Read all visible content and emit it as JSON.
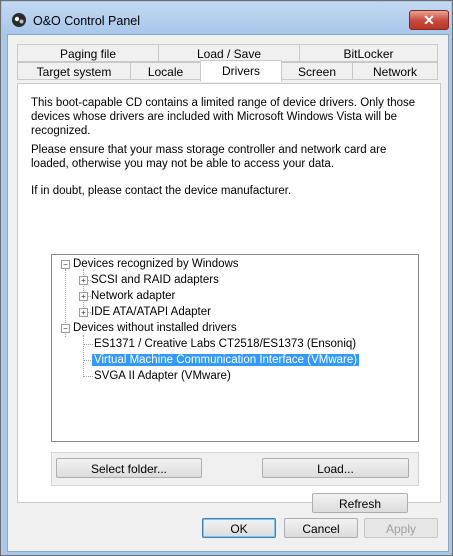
{
  "window": {
    "title": "O&O Control Panel",
    "close_symbol": "✕"
  },
  "tabs": {
    "row1": [
      {
        "label": "Paging file"
      },
      {
        "label": "Load / Save"
      },
      {
        "label": "BitLocker"
      }
    ],
    "row2": [
      {
        "label": "Target system"
      },
      {
        "label": "Locale"
      },
      {
        "label": "Drivers",
        "active": true
      },
      {
        "label": "Screen"
      },
      {
        "label": "Network"
      }
    ]
  },
  "drivers": {
    "paragraphs": [
      "This boot-capable CD contains a limited range of device drivers. Only those devices whose drivers are included with Microsoft Windows Vista will be recognized.",
      "Please ensure that your mass storage controller and network card are loaded, otherwise you may not be able to access your data.",
      "If in doubt, please contact the device manufacturer."
    ],
    "tree": [
      {
        "label": "Devices recognized by Windows",
        "expander": "−"
      },
      {
        "label": "SCSI and RAID adapters",
        "expander": "+"
      },
      {
        "label": "Network adapter",
        "expander": "+"
      },
      {
        "label": "IDE ATA/ATAPI Adapter",
        "expander": "+"
      },
      {
        "label": "Devices without installed drivers",
        "expander": "−"
      },
      {
        "label": "ES1371 / Creative Labs CT2518/ES1373 (Ensoniq)"
      },
      {
        "label": "Virtual Machine Communication Interface (VMware)",
        "selected": true
      },
      {
        "label": "SVGA II Adapter (VMware)"
      }
    ],
    "select_folder_label": "Select folder...",
    "load_label": "Load...",
    "refresh_label": "Refresh"
  },
  "footer": {
    "ok_label": "OK",
    "cancel_label": "Cancel",
    "apply_label": "Apply"
  }
}
